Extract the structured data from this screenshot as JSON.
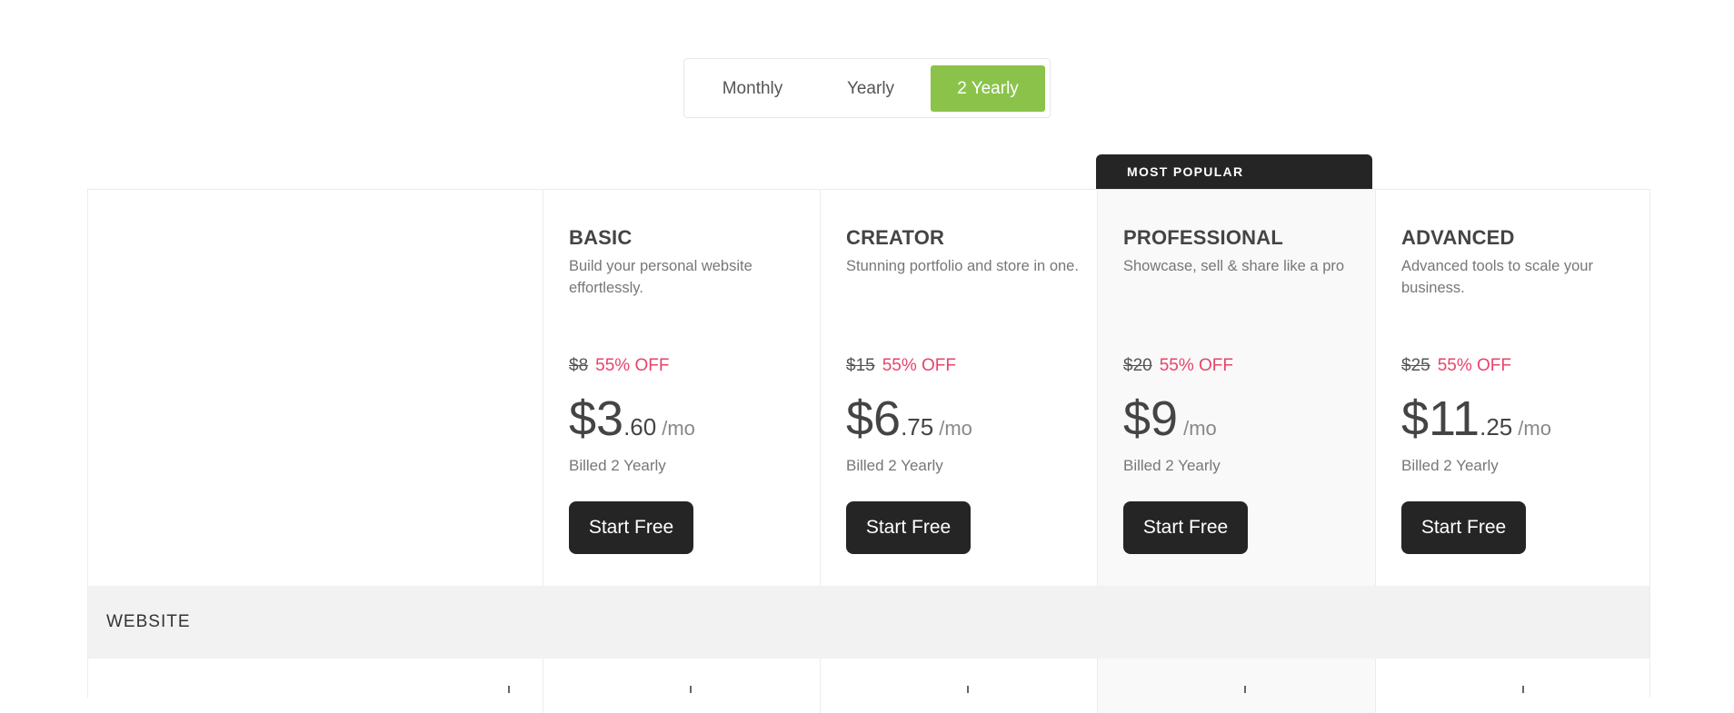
{
  "billing_toggle": {
    "options": [
      "Monthly",
      "Yearly",
      "2 Yearly"
    ],
    "selected": "2 Yearly",
    "accent_color": "#8bc34a"
  },
  "badge": {
    "label": "MOST POPULAR"
  },
  "plans": [
    {
      "name": "BASIC",
      "description": "Build your personal website effortlessly.",
      "old_price": "$8",
      "discount": "55% OFF",
      "price_main": "$3",
      "price_cents": ".60",
      "unit": "/mo",
      "billed": "Billed 2 Yearly",
      "cta": "Start Free"
    },
    {
      "name": "CREATOR",
      "description": "Stunning portfolio and store in one.",
      "old_price": "$15",
      "discount": "55% OFF",
      "price_main": "$6",
      "price_cents": ".75",
      "unit": "/mo",
      "billed": "Billed 2 Yearly",
      "cta": "Start Free"
    },
    {
      "name": "PROFESSIONAL",
      "description": "Showcase, sell & share like a pro",
      "old_price": "$20",
      "discount": "55% OFF",
      "price_main": "$9",
      "price_cents": "",
      "unit": "/mo",
      "billed": "Billed 2 Yearly",
      "cta": "Start Free"
    },
    {
      "name": "ADVANCED",
      "description": "Advanced tools to scale your business.",
      "old_price": "$25",
      "discount": "55% OFF",
      "price_main": "$11",
      "price_cents": ".25",
      "unit": "/mo",
      "billed": "Billed 2 Yearly",
      "cta": "Start Free"
    }
  ],
  "sections": [
    {
      "label": "WEBSITE"
    }
  ],
  "colors": {
    "discount": "#e8436b",
    "button": "#252525",
    "highlight_column": "#f9f9f9",
    "section_band": "#f2f2f2"
  }
}
